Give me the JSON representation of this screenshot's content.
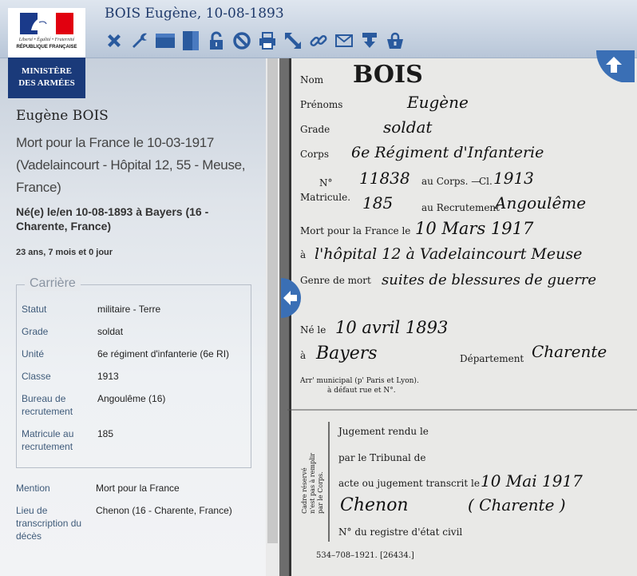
{
  "header": {
    "title": "BOIS Eugène, 10-08-1893",
    "tools": [
      {
        "name": "close-icon",
        "color": "#2a5a9e"
      },
      {
        "name": "wrench-icon",
        "color": "#2a5a9e"
      },
      {
        "name": "layout-wide-icon",
        "color": "#2a5a9e"
      },
      {
        "name": "layout-half-icon",
        "color": "#2a5a9e"
      },
      {
        "name": "lock-icon",
        "color": "#2a5a9e"
      },
      {
        "name": "forbidden-icon",
        "color": "#2a5a9e"
      },
      {
        "name": "print-icon",
        "color": "#2a5a9e"
      },
      {
        "name": "expand-icon",
        "color": "#2a5a9e"
      },
      {
        "name": "link-icon",
        "color": "#2a5a9e"
      },
      {
        "name": "mail-icon",
        "color": "#2a5a9e"
      },
      {
        "name": "download-icon",
        "color": "#2a5a9e"
      },
      {
        "name": "basket-lock-icon",
        "color": "#2a5a9e"
      }
    ]
  },
  "logo": {
    "motto": "Liberté • Égalité • Fraternité",
    "republic": "RÉPUBLIQUE FRANÇAISE",
    "ministry_line1": "MINISTÈRE",
    "ministry_line2": "DES ARMÉES"
  },
  "person": {
    "name": "Eugène BOIS",
    "death": "Mort pour la France le 10-03-1917 (Vadelaincourt - Hôpital 12, 55 - Meuse, France)",
    "birth": "Né(e) le/en 10-08-1893 à Bayers (16 - Charente, France)",
    "age": "23 ans, 7 mois et 0 jour"
  },
  "career": {
    "legend": "Carrière",
    "fields": [
      {
        "label": "Statut",
        "value": "militaire - Terre"
      },
      {
        "label": "Grade",
        "value": "soldat"
      },
      {
        "label": "Unité",
        "value": "6e régiment d'infanterie (6e RI)"
      },
      {
        "label": "Classe",
        "value": "1913"
      },
      {
        "label": "Bureau de recrutement",
        "value": "Angoulême (16)"
      },
      {
        "label": "Matricule au recrutement",
        "value": "185"
      }
    ]
  },
  "extra": [
    {
      "label": "Mention",
      "value": "Mort pour la France"
    },
    {
      "label": "Lieu de transcription du décès",
      "value": "Chenon (16 - Charente, France)"
    }
  ],
  "document": {
    "surname": "BOIS",
    "printed": {
      "nom": "Nom",
      "prenoms": "Prénoms",
      "grade": "Grade",
      "corps": "Corps",
      "no": "N°",
      "au_corps": "au Corps. —",
      "cl": "Cl.",
      "matricule": "Matricule.",
      "au_recrutement": "au Recrutement",
      "mort_pour": "Mort pour la France le",
      "a": "à",
      "genre_mort": "Genre de mort",
      "ne_le": "Né le",
      "departement": "Département",
      "arr1": "Arr' municipal (p' Paris et Lyon).",
      "arr2": "à défaut rue et N°.",
      "jugement": "Jugement rendu le",
      "tribunal": "par le Tribunal de",
      "acte": "acte ou jugement transcrit le",
      "registre": "N° du registre d'état civil",
      "side1": "Cadre réservé",
      "side2": "n'est pas à remplir",
      "side3": "par le Corps.",
      "footer": "534–708–1921. [26434.]"
    },
    "handwritten": {
      "prenom": "Eugène",
      "grade": "soldat",
      "corps": "6e Régiment d'Infanterie",
      "no": "11838",
      "classe": "1913",
      "matricule": "185",
      "recrutement": "Angoulême",
      "date_mort": "10 Mars 1917",
      "lieu_mort": "l'hôpital 12 à Vadelaincourt Meuse",
      "genre_mort": "suites de blessures de guerre",
      "date_naissance": "10 avril 1893",
      "lieu_naissance": "Bayers",
      "departement": "Charente",
      "transcription_date": "10 Mai 1917",
      "transcription_lieu": "Chenon",
      "transcription_dept": "( Charente )"
    }
  }
}
